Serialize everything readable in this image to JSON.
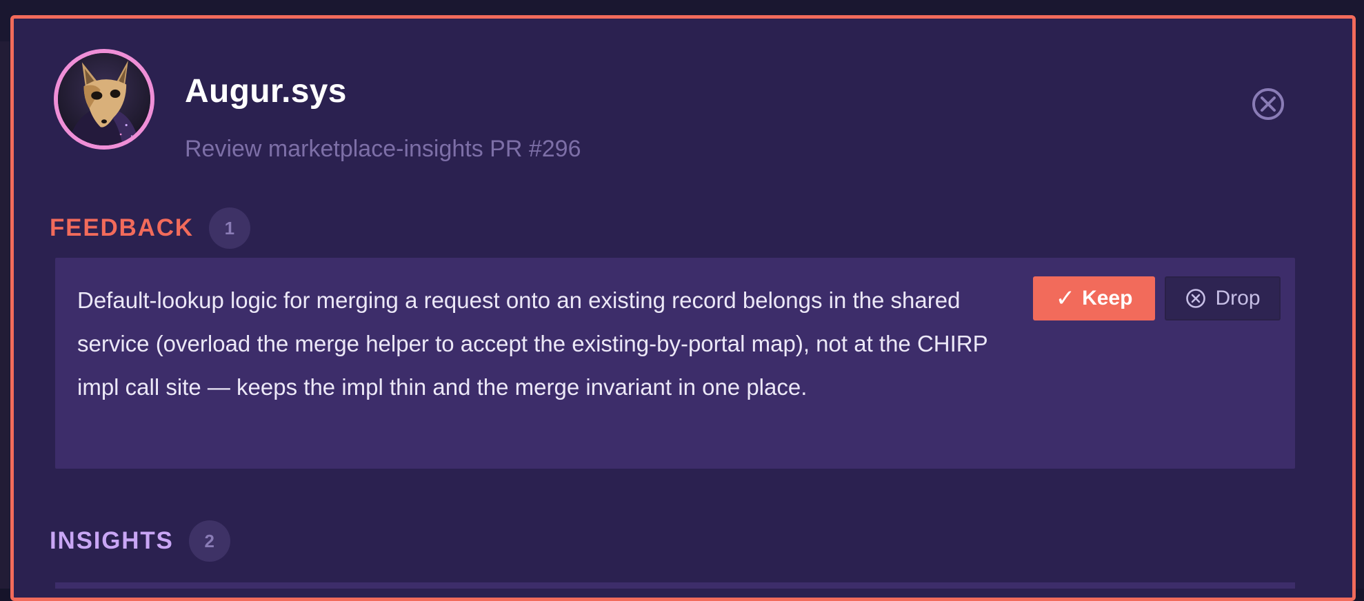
{
  "agent": {
    "name": "Augur.sys",
    "subtitle": "Review marketplace-insights PR #296"
  },
  "sections": {
    "feedback": {
      "title": "FEEDBACK",
      "count": "1",
      "items": [
        {
          "text": "Default-lookup logic for merging a request onto an existing record belongs in the shared service (overload the merge helper to accept the existing-by-portal map), not at the CHIRP impl call site — keeps the impl thin and the merge invariant in one place.",
          "keep_label": "Keep",
          "drop_label": "Drop"
        }
      ]
    },
    "insights": {
      "title": "INSIGHTS",
      "count": "2"
    }
  },
  "icons": {
    "close": "close-circle-icon",
    "keep": "checkmark-icon",
    "drop": "close-circle-icon",
    "avatar": "fox-mask-avatar"
  },
  "colors": {
    "accent": "#f26b5b",
    "panel_bg": "#2b2150",
    "card_bg": "#3d2d6a",
    "feedback_title": "#f26b5b",
    "insights_title": "#c9a6f5",
    "avatar_ring": "#ef8fd7"
  }
}
